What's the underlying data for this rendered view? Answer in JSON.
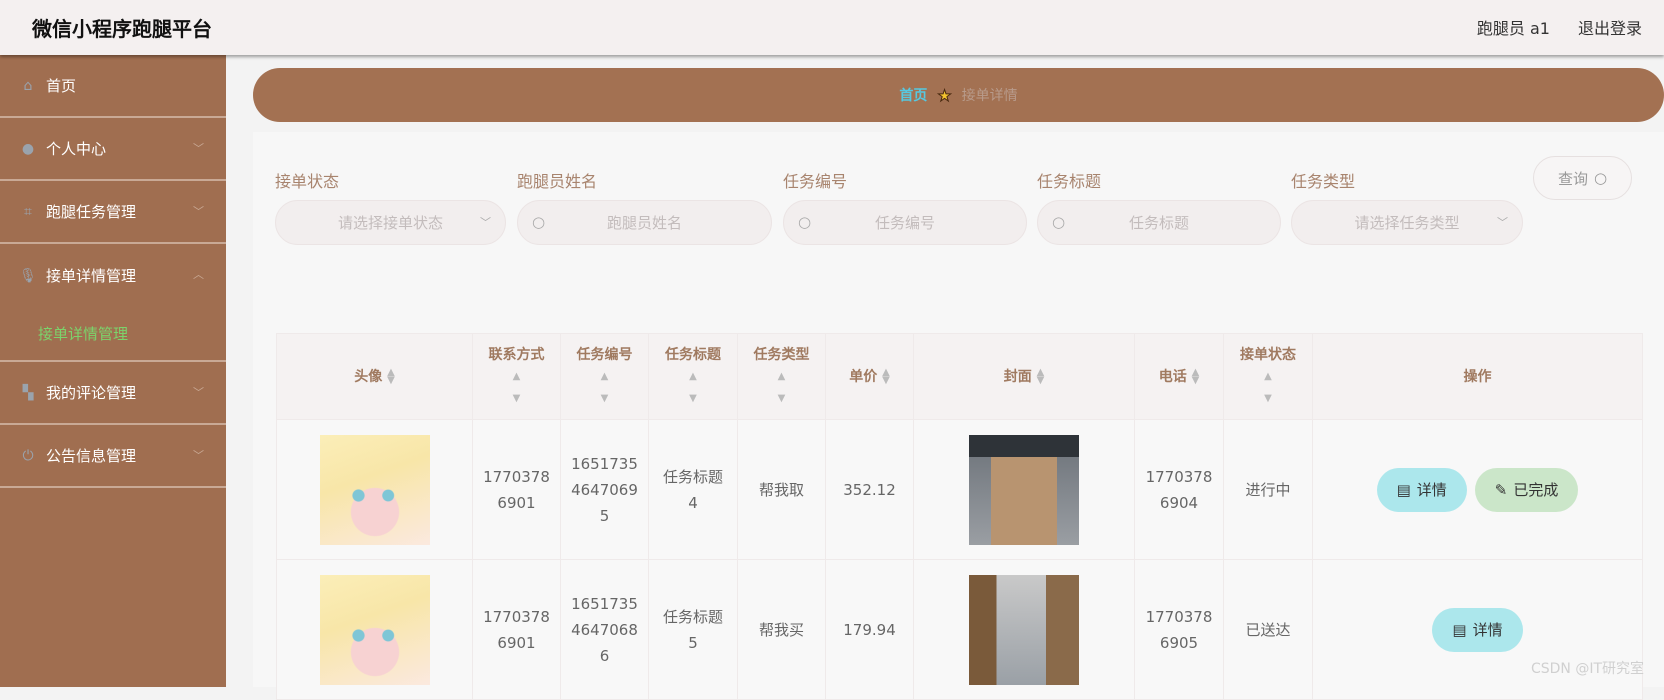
{
  "header": {
    "title": "微信小程序跑腿平台",
    "user": "跑腿员 a1",
    "logout": "退出登录"
  },
  "sidebar": {
    "items": [
      {
        "label": "首页",
        "icon": "home-icon"
      },
      {
        "label": "个人中心",
        "icon": "user-icon"
      },
      {
        "label": "跑腿任务管理",
        "icon": "crop-icon"
      },
      {
        "label": "接单详情管理",
        "icon": "microphone-icon",
        "expanded": true,
        "sub": "接单详情管理"
      },
      {
        "label": "我的评论管理",
        "icon": "ticket-icon"
      },
      {
        "label": "公告信息管理",
        "icon": "power-icon"
      }
    ]
  },
  "breadcrumb": {
    "home": "首页",
    "current": "接单详情"
  },
  "filters": [
    {
      "label": "接单状态",
      "placeholder": "请选择接单状态",
      "type": "select"
    },
    {
      "label": "跑腿员姓名",
      "placeholder": "跑腿员姓名",
      "type": "search"
    },
    {
      "label": "任务编号",
      "placeholder": "任务编号",
      "type": "search"
    },
    {
      "label": "任务标题",
      "placeholder": "任务标题",
      "type": "search"
    },
    {
      "label": "任务类型",
      "placeholder": "请选择任务类型",
      "type": "select"
    }
  ],
  "query_label": "查询",
  "table": {
    "headers": [
      "头像",
      "联系方式",
      "任务编号",
      "任务标题",
      "任务类型",
      "单价",
      "封面",
      "电话",
      "接单状态",
      "操作"
    ],
    "rows": [
      {
        "contact": "17703786901",
        "task_no": "16517354647069 5",
        "title": "任务标题4",
        "type": "帮我取",
        "price": "352.12",
        "phone": "17703786904",
        "status": "进行中",
        "actions": [
          "详情",
          "已完成"
        ]
      },
      {
        "contact": "17703786901",
        "task_no": "16517354647068 6",
        "title": "任务标题5",
        "type": "帮我买",
        "price": "179.94",
        "phone": "17703786905",
        "status": "已送达",
        "actions": [
          "详情"
        ]
      }
    ]
  },
  "watermark": "CSDN @IT研究室",
  "colors": {
    "sidebar": "#a06e50",
    "breadcrumb": "#a37152",
    "active_sub": "#7cd36b",
    "detail_btn": "#ace7ec",
    "done_btn": "#cbe6c9"
  }
}
